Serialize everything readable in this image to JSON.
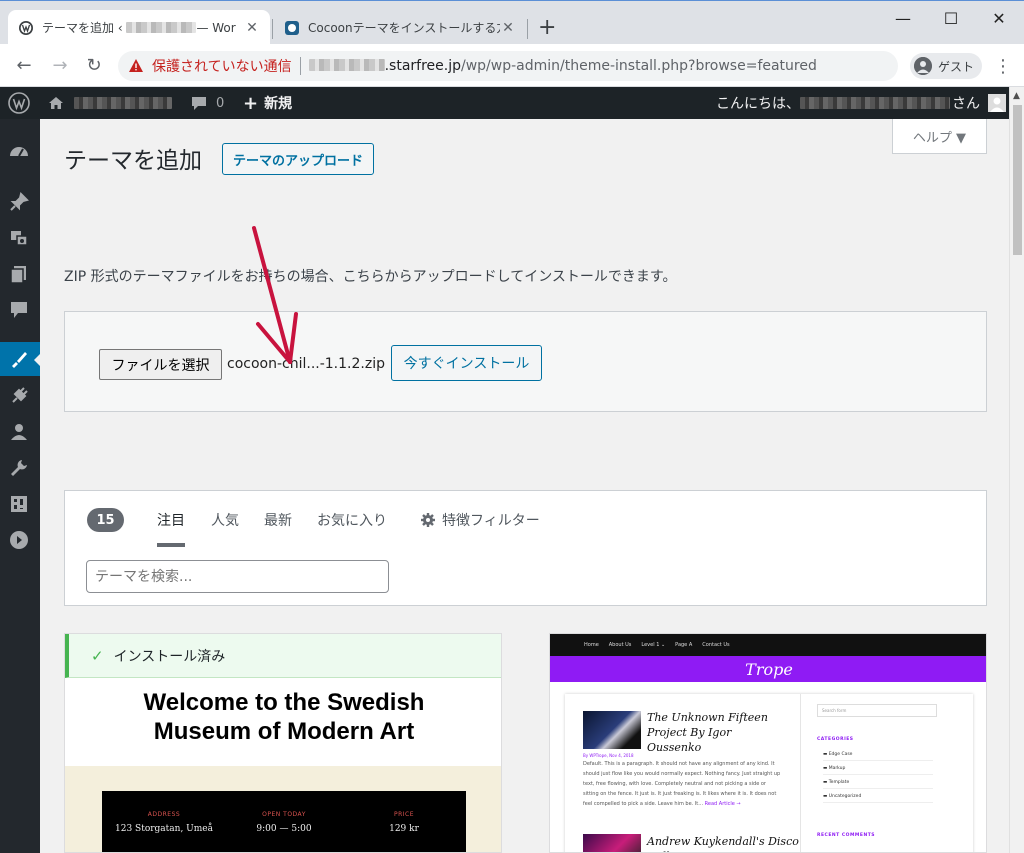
{
  "browser": {
    "tabs": [
      {
        "title": "テーマを追加 ‹ ",
        "title_suffix": "— Wor"
      },
      {
        "title": "Cocoonテーマをインストールする方法"
      }
    ],
    "address": {
      "security_label": "保護されていない通信",
      "url_host_suffix": ".starfree.jp",
      "url_path": "/wp/wp-admin/theme-install.php?browse=featured"
    },
    "profile_label": "ゲスト"
  },
  "adminbar": {
    "comments_count": "0",
    "new_label": "新規",
    "greeting_prefix": "こんにちは、",
    "greeting_suffix": "さん"
  },
  "page": {
    "title": "テーマを追加",
    "upload_button": "テーマのアップロード",
    "help_label": "ヘルプ ▼",
    "upload_description": "ZIP 形式のテーマファイルをお持ちの場合、こちらからアップロードしてインストールできます。",
    "file_button": "ファイルを選択",
    "file_name": "cocoon-chil...-1.1.2.zip",
    "install_button": "今すぐインストール"
  },
  "filter": {
    "count": "15",
    "tabs": [
      "注目",
      "人気",
      "最新",
      "お気に入り"
    ],
    "feature_filter": "特徴フィルター",
    "search_placeholder": "テーマを検索..."
  },
  "themes": {
    "card1": {
      "installed_label": "インストール済み",
      "headline_1": "Welcome to the Swedish",
      "headline_2": "Museum of Modern Art",
      "cols": [
        {
          "label": "ADDRESS",
          "value": "123 Storgatan, Umeå"
        },
        {
          "label": "OPEN TODAY",
          "value": "9:00 — 5:00"
        },
        {
          "label": "PRICE",
          "value": "129 kr"
        }
      ]
    },
    "card2": {
      "nav": [
        "Home",
        "About Us",
        "Level 1 ⌄",
        "Page A",
        "Contact Us"
      ],
      "site_title": "Trope",
      "post1_title": "The Unknown Fifteen Project By Igor Oussenko",
      "post1_meta": "By WPTrope, Nov 4, 2018",
      "post1_excerpt": "Default. This is a paragraph. It should not have any alignment of any kind. It should just flow like you would normally expect. Nothing fancy. Just straight up text, free flowing, with love. Completely neutral and not picking a side or sitting on the fence. It just is. It just freaking is. It likes where it is. It does not feel compelled to pick a side. Leave him be. It...",
      "read_more": "Read Article →",
      "post2_title": "Andrew Kuykendall's Disco Dolls",
      "search_placeholder": "Search form",
      "categories_heading": "CATEGORIES",
      "categories": [
        "Edge Case",
        "Markup",
        "Template",
        "Uncategorized"
      ],
      "recent_comments_heading": "RECENT COMMENTS"
    }
  },
  "colors": {
    "admin_bar": "#1d2327",
    "sidebar": "#23282d",
    "active_menu": "#0073aa",
    "link_blue": "#0071a1",
    "arrow": "#c8133e",
    "installed_green": "#46b450",
    "trope_purple": "#8f1bf4"
  }
}
